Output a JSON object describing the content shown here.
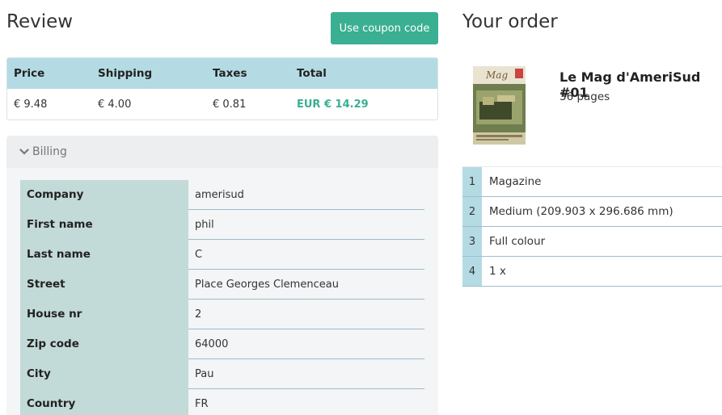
{
  "review": {
    "title": "Review",
    "coupon_label": "Use coupon code"
  },
  "pricing": {
    "headers": [
      "Price",
      "Shipping",
      "Taxes",
      "Total"
    ],
    "values": [
      "€ 9.48",
      "€ 4.00",
      "€ 0.81",
      "EUR € 14.29"
    ]
  },
  "billing": {
    "title": "Billing",
    "rows": [
      {
        "label": "Company",
        "value": "amerisud"
      },
      {
        "label": "First name",
        "value": "phil"
      },
      {
        "label": "Last name",
        "value": "C"
      },
      {
        "label": "Street",
        "value": "Place Georges Clemenceau"
      },
      {
        "label": "House nr",
        "value": "2"
      },
      {
        "label": "Zip code",
        "value": "64000"
      },
      {
        "label": "City",
        "value": "Pau"
      },
      {
        "label": "Country",
        "value": "FR"
      }
    ]
  },
  "order": {
    "title": "Your order",
    "product_name": "Le Mag d'AmeriSud #01",
    "pages": "36 pages",
    "specs": [
      {
        "num": "1",
        "text": "Magazine"
      },
      {
        "num": "2",
        "text": "Medium (209.903 x 296.686 mm)"
      },
      {
        "num": "3",
        "text": "Full colour"
      },
      {
        "num": "4",
        "text": "1 x"
      }
    ]
  },
  "colors": {
    "accent": "#3aaf92",
    "table_header": "#b4dbe3",
    "billing_label": "#c2dad8"
  }
}
